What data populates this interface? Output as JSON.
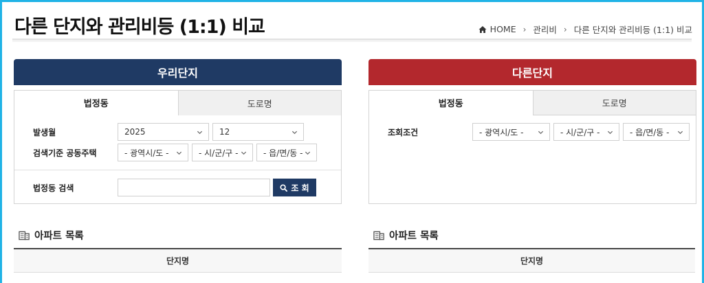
{
  "page": {
    "title": "다른 단지와 관리비등 (1:1) 비교"
  },
  "breadcrumb": {
    "home": "HOME",
    "level1": "관리비",
    "current": "다른 단지와 관리비등 (1:1) 비교"
  },
  "left_panel": {
    "header": "우리단지",
    "tabs": [
      {
        "label": "법정동",
        "active": true
      },
      {
        "label": "도로명",
        "active": false
      }
    ],
    "month_label": "발생월",
    "year_value": "2025",
    "month_value": "12",
    "criteria_label": "검색기준 공동주택",
    "sido_value": "- 광역시/도 -",
    "sigungu_value": "- 시/군/구 -",
    "dong_value": "- 읍/면/동 -",
    "search_label": "법정동 검색",
    "search_value": "",
    "search_button": "조 회",
    "list_title": "아파트 목록",
    "col_name": "단지명"
  },
  "right_panel": {
    "header": "다른단지",
    "tabs": [
      {
        "label": "법정동",
        "active": true
      },
      {
        "label": "도로명",
        "active": false
      }
    ],
    "criteria_label": "조회조건",
    "sido_value": "- 광역시/도 -",
    "sigungu_value": "- 시/군/구 -",
    "dong_value": "- 읍/면/동 -",
    "list_title": "아파트 목록",
    "col_name": "단지명"
  },
  "colors": {
    "frame": "#20b3e6",
    "left_accent": "#1f3a64",
    "right_accent": "#b3282d"
  }
}
